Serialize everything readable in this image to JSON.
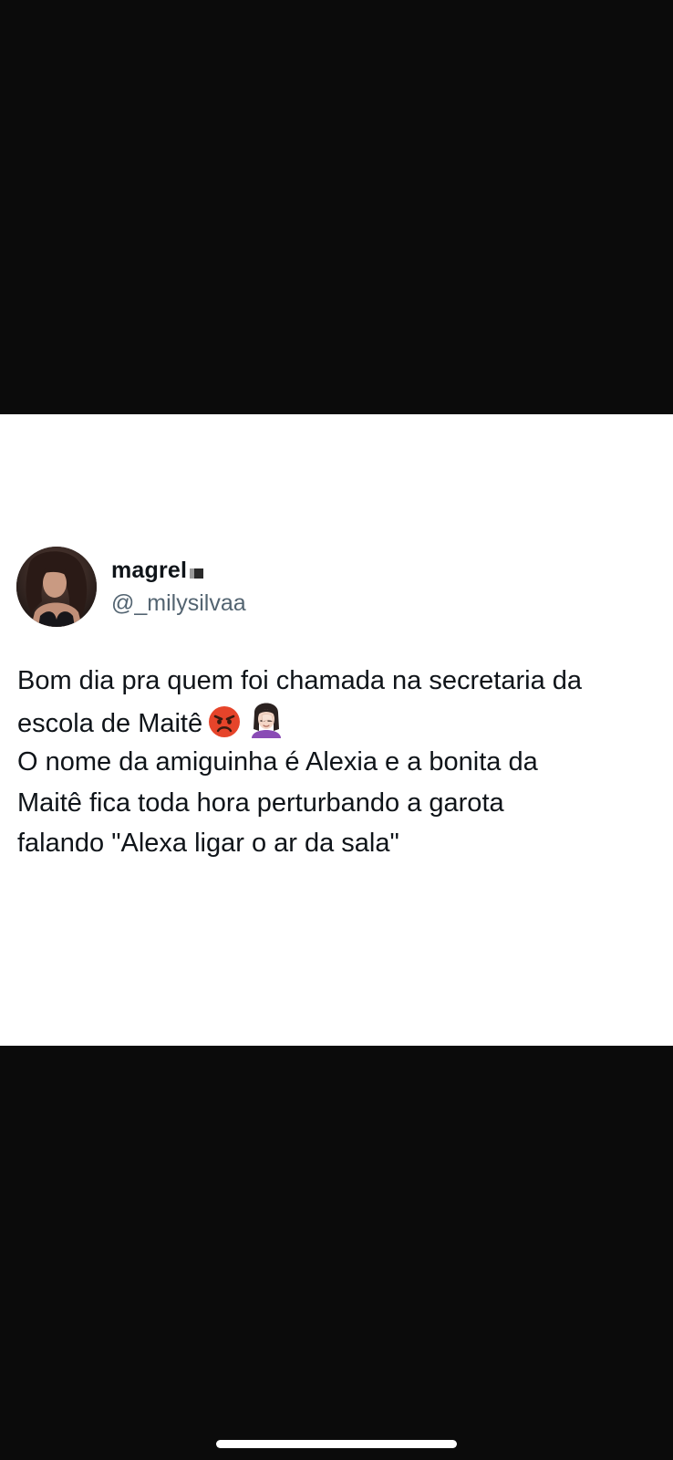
{
  "tweet": {
    "display_name": "magrel",
    "handle": "@_milysilvaa",
    "text_lines": [
      "Bom dia pra quem foi chamada na secretaria da",
      "escola de Maitê",
      "O nome da amiguinha é Alexia e a bonita da",
      "Maitê fica toda hora perturbando a garota",
      "falando \"Alexa ligar o ar da sala\""
    ],
    "emojis": [
      "angry-face-emoji",
      "woman-facepalming-emoji"
    ]
  },
  "colors": {
    "background": "#0b0b0b",
    "card": "#ffffff",
    "text": "#0f1419",
    "handle": "#536471",
    "angry_face": "#e6442a"
  }
}
